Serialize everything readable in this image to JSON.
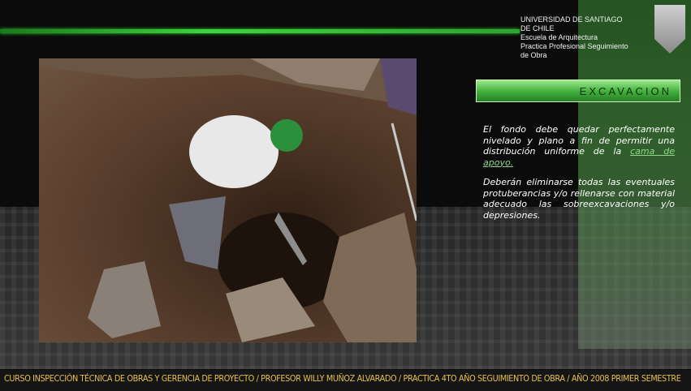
{
  "header": {
    "university_line1": "UNIVERSIDAD DE SANTIAGO",
    "university_line2": "DE CHILE",
    "school": "Escuela  de Arquitectura",
    "course_line1": "Practica Profesional Seguimiento",
    "course_line2": "de Obra"
  },
  "section": {
    "title": "EXCAVACION"
  },
  "content": {
    "paragraph1_text": "El fondo debe quedar perfectamente nivelado y plano a fin de permitir una distribución uniforme de la ",
    "paragraph1_link": "cama de apoyo.",
    "paragraph2": "Deberán eliminarse todas las eventuales protuberancias y/o rellenarse con material adecuado las sobreexcavaciones y/o depresiones."
  },
  "footer": {
    "text": "CURSO INSPECCIÓN TÉCNICA DE OBRAS Y GERENCIA DE PROYECTO /  PROFESOR  WILLY MUÑOZ ALVARADO /  PRACTICA 4TO AÑO SEGUIMIENTO DE OBRA / AÑO 2008 PRIMER SEMESTRE"
  },
  "colors": {
    "accent_green": "#3ed43e",
    "footer_text": "#e6c04a",
    "link_green": "#8fd98a"
  }
}
